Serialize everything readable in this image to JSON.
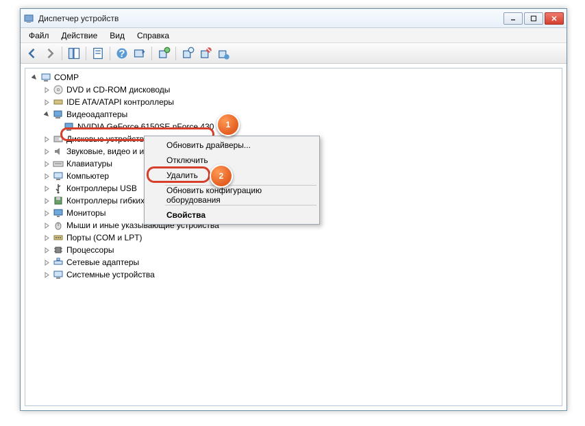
{
  "window": {
    "title": "Диспетчер устройств"
  },
  "menu": {
    "file": "Файл",
    "action": "Действие",
    "view": "Вид",
    "help": "Справка"
  },
  "tree": {
    "root": "COMP",
    "items": [
      "DVD и CD-ROM дисководы",
      "IDE ATA/ATAPI контроллеры",
      "Видеоадаптеры",
      "Дисковые устройства",
      "Звуковые, видео и игровые устройства",
      "Клавиатуры",
      "Компьютер",
      "Контроллеры USB",
      "Контроллеры гибких дисков",
      "Мониторы",
      "Мыши и иные указывающие устройства",
      "Порты (COM и LPT)",
      "Процессоры",
      "Сетевые адаптеры",
      "Системные устройства"
    ],
    "selected_device": "NVIDIA GeForce 6150SE nForce 430"
  },
  "context_menu": {
    "update_drivers": "Обновить драйверы...",
    "disable": "Отключить",
    "remove": "Удалить",
    "scan_hardware": "Обновить конфигурацию оборудования",
    "properties": "Свойства"
  },
  "callouts": {
    "one": "1",
    "two": "2"
  }
}
